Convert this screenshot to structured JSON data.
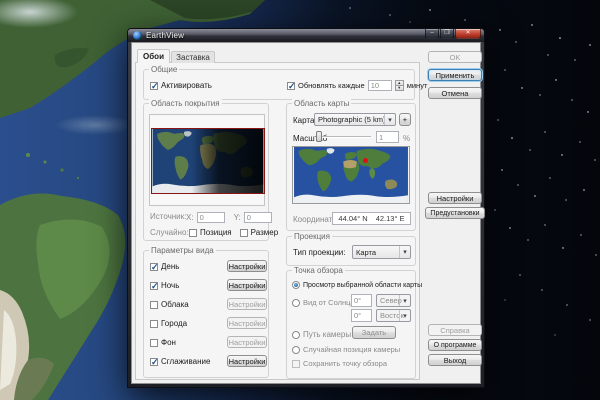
{
  "window": {
    "title": "EarthView",
    "controls": {
      "minimize": "–",
      "maximize": "❐",
      "close": "✕"
    },
    "tabs": [
      {
        "label": "Обои"
      },
      {
        "label": "Заставка"
      }
    ]
  },
  "general": {
    "label": "Общие",
    "activate": {
      "label": "Активировать",
      "checked": true
    },
    "update": {
      "label": "Обновлять каждые",
      "checked": true,
      "value": "10",
      "suffix": "минут"
    }
  },
  "coverage": {
    "label": "Область покрытия",
    "source_label": "Источник:",
    "x_label": "X:",
    "x_value": "0",
    "y_label": "Y:",
    "y_value": "0",
    "random_label": "Случайно:",
    "position": {
      "label": "Позиция",
      "checked": false
    },
    "size": {
      "label": "Размер",
      "checked": false
    }
  },
  "view_params": {
    "label": "Параметры вида",
    "settings_label": "Настройки",
    "rows": [
      {
        "label": "День",
        "checked": true,
        "enabled": true
      },
      {
        "label": "Ночь",
        "checked": true,
        "enabled": true
      },
      {
        "label": "Облака",
        "checked": false,
        "enabled": false
      },
      {
        "label": "Города",
        "checked": false,
        "enabled": false
      },
      {
        "label": "Фон",
        "checked": false,
        "enabled": false
      },
      {
        "label": "Сглаживание",
        "checked": true,
        "enabled": true
      }
    ]
  },
  "map_area": {
    "label": "Область карты",
    "map_label": "Карта:",
    "map_value": "Photographic (5 km)",
    "add_button": "+",
    "scale_label": "Масштаб",
    "scale_value": "1",
    "scale_unit": "%",
    "coords_label": "Координаты:",
    "lat": "44.04° N",
    "lon": "42.13° E"
  },
  "projection": {
    "label": "Проекция",
    "type_label": "Тип проекции:",
    "type_value": "Карта"
  },
  "viewpoint": {
    "label": "Точка обзора",
    "option_map": "Просмотр выбранной области карты",
    "option_sun": "Вид от Солнца +",
    "sun_deg1": "0°",
    "sun_dir1": "Север",
    "sun_deg2": "0°",
    "sun_dir2": "Восток",
    "option_path": "Путь камеры",
    "path_button": "Задать",
    "option_random": "Случайная позиция камеры",
    "save_label": "Сохранить точку обзора",
    "selected": "option_map"
  },
  "side_buttons": {
    "ok": "OK",
    "apply": "Применить",
    "cancel": "Отмена",
    "settings": "Настройки",
    "presets": "Предустановки",
    "help": "Справка",
    "about": "О программе",
    "exit": "Выход"
  },
  "colors": {
    "focus_ring": "#3c7fb1",
    "close_button": "#c0402f",
    "marker_red": "#e01010",
    "map_border": "#8a1515",
    "ocean_day": "#2b4f8e",
    "night_side": "#04060c"
  }
}
